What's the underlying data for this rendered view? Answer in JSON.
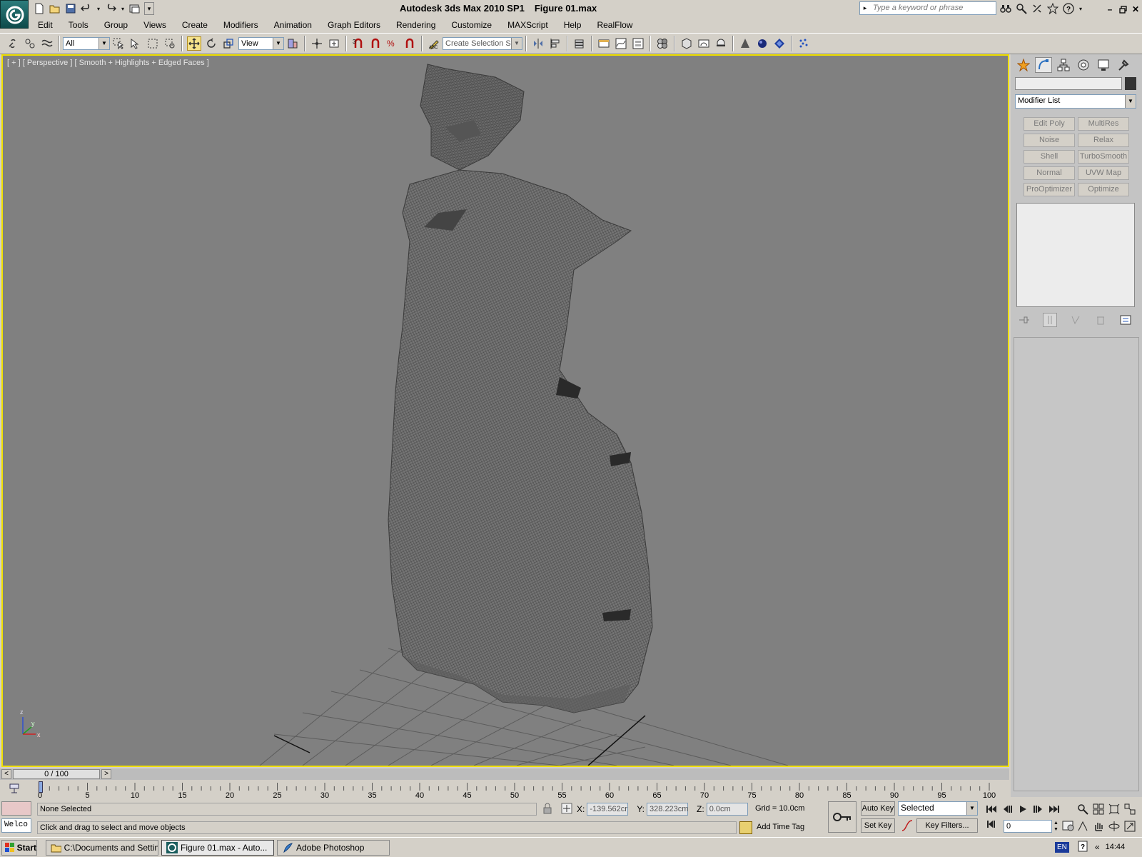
{
  "app": {
    "title": "Autodesk 3ds Max  2010 SP1",
    "file": "Figure 01.max",
    "search_placeholder": "Type a keyword or phrase"
  },
  "menu": [
    "Edit",
    "Tools",
    "Group",
    "Views",
    "Create",
    "Modifiers",
    "Animation",
    "Graph Editors",
    "Rendering",
    "Customize",
    "MAXScript",
    "Help",
    "RealFlow"
  ],
  "toolbar": {
    "selection_filter": "All",
    "ref_coord": "View",
    "named_selection": "Create Selection Se"
  },
  "viewport": {
    "label": "[ + ] [ Perspective ] [ Smooth + Highlights + Edged Faces ]",
    "axis_labels": {
      "z": "z",
      "y": "y",
      "x": "x"
    }
  },
  "command_panel": {
    "modifier_list": "Modifier List",
    "modifier_buttons": [
      "Edit Poly",
      "MultiRes",
      "Noise",
      "Relax",
      "Shell",
      "TurboSmooth",
      "Normal",
      "UVW Map",
      "ProOptimizer",
      "Optimize"
    ]
  },
  "time_slider": {
    "value": "0 / 100",
    "prev": "<",
    "next": ">",
    "ticks": [
      "0",
      "5",
      "10",
      "15",
      "20",
      "25",
      "30",
      "35",
      "40",
      "45",
      "50",
      "55",
      "60",
      "65",
      "70",
      "75",
      "80",
      "85",
      "90",
      "95",
      "100"
    ]
  },
  "status": {
    "maxscript": "Welco",
    "selection": "None Selected",
    "prompt": "Click and drag to select and move objects",
    "x_label": "X:",
    "x_value": "-139.562cr",
    "y_label": "Y:",
    "y_value": "328.223cm",
    "z_label": "Z:",
    "z_value": "0.0cm",
    "grid": "Grid = 10.0cm",
    "add_time_tag": "Add Time Tag",
    "auto_key": "Auto Key",
    "set_key": "Set Key",
    "key_mode": "Selected",
    "key_filters": "Key Filters...",
    "frame": "0"
  },
  "taskbar": {
    "start": "Start",
    "tasks": [
      "C:\\Documents and Settin...",
      "Figure 01.max - Auto...",
      "Adobe Photoshop"
    ],
    "lang": "EN",
    "time": "14:44",
    "chevron": "«"
  },
  "colors": {
    "viewport_bg": "#808080",
    "viewport_border": "#f0e000",
    "mesh": "#6a6a6a",
    "ui_face": "#d4d0c8"
  }
}
